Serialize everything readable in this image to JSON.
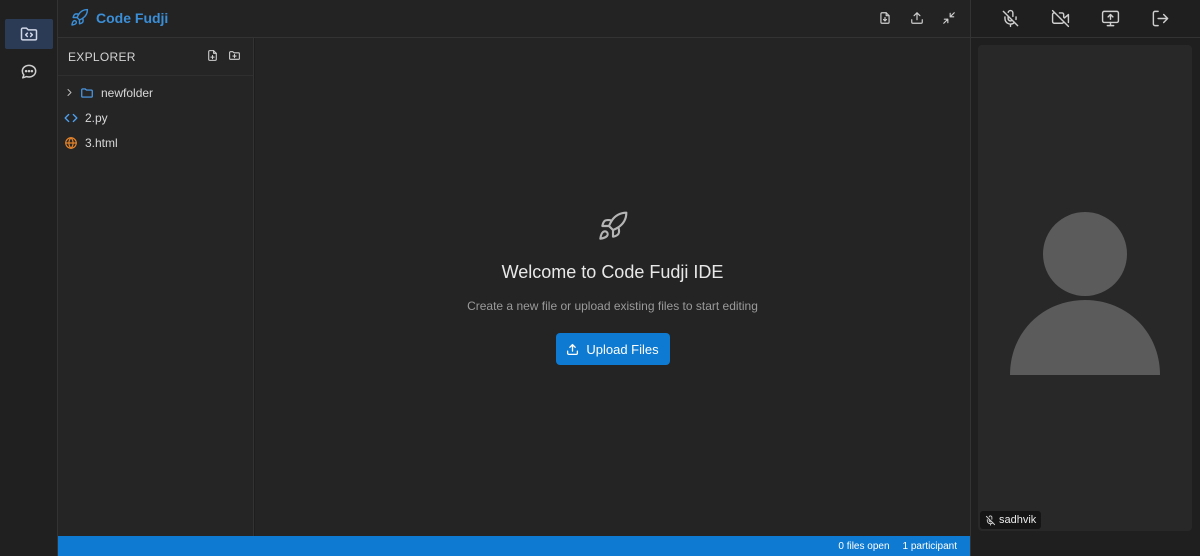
{
  "app": {
    "name": "Code Fudji",
    "brand_color": "#3b8fd8",
    "brand_icon": "rocket-icon"
  },
  "activity_bar": {
    "items": [
      {
        "icon": "folder-code-icon",
        "active": true
      },
      {
        "icon": "chat-icon",
        "active": false
      }
    ]
  },
  "topbar": {
    "actions": [
      "new-file-download-icon",
      "upload-icon",
      "minimize-icon"
    ]
  },
  "explorer": {
    "title": "EXPLORER",
    "actions": [
      "new-file-icon",
      "new-folder-icon"
    ],
    "items": [
      {
        "label": "newfolder",
        "type": "folder",
        "icon": "folder-icon",
        "expanded": false
      },
      {
        "label": "2.py",
        "type": "file",
        "icon": "code-icon"
      },
      {
        "label": "3.html",
        "type": "file",
        "icon": "globe-icon"
      }
    ]
  },
  "welcome": {
    "icon": "rocket-icon",
    "title": "Welcome to Code Fudji IDE",
    "subtitle": "Create a new file or upload existing files to start editing",
    "upload_label": "Upload Files"
  },
  "video": {
    "controls": [
      "mic-off-icon",
      "video-off-icon",
      "screen-share-icon",
      "leave-icon"
    ],
    "participant_name": "sadhvik",
    "muted": true
  },
  "status": {
    "files_open": "0 files open",
    "participants": "1 participant"
  },
  "colors": {
    "accent": "#0e7ad1",
    "background": "#1e1e1e",
    "panel": "#252526"
  }
}
